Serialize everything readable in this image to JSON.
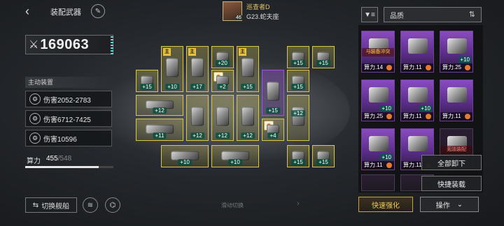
{
  "header": {
    "back_icon": "back-arrow-icon",
    "title": "装配武器",
    "edit_icon": "pencil-icon"
  },
  "pilot": {
    "name": "巡查者D",
    "level": "46",
    "ship": "G23.蛇夫座"
  },
  "power": {
    "value": "169063",
    "icon": "crossed-swords-icon"
  },
  "active_equipment": {
    "label": "主动装置",
    "items": [
      {
        "text": "伤害2052-2783",
        "icon": "gear-icon"
      },
      {
        "text": "伤害6712-7425",
        "icon": "gear-icon"
      },
      {
        "text": "伤害10596",
        "icon": "gear-icon"
      }
    ]
  },
  "capacity": {
    "label": "算力",
    "current": "455",
    "max": "/548",
    "fraction": 0.83
  },
  "bottom": {
    "switch_ship": "切换舰船",
    "swipe_hint": "滑动切换"
  },
  "slots": [
    {
      "level": "+15",
      "badge": ""
    },
    {
      "level": "+10",
      "badge": "主"
    },
    {
      "level": "+17",
      "badge": "主"
    },
    {
      "level": "+20",
      "badge": ""
    },
    {
      "level": "+15",
      "badge": "主"
    },
    {
      "level": "+15",
      "badge": ""
    },
    {
      "level": "+15",
      "badge": ""
    },
    {
      "level": "+2",
      "badge": ""
    },
    {
      "level": "+15",
      "badge": ""
    },
    {
      "level": "+15",
      "badge": ""
    },
    {
      "level": "+12",
      "badge": ""
    },
    {
      "level": "+12",
      "badge": ""
    },
    {
      "level": "+12",
      "badge": ""
    },
    {
      "level": "+12",
      "badge": ""
    },
    {
      "level": "+11",
      "badge": ""
    },
    {
      "level": "+4",
      "badge": ""
    },
    {
      "level": "+10",
      "badge": ""
    },
    {
      "level": "+10",
      "badge": ""
    },
    {
      "level": "+15",
      "badge": ""
    },
    {
      "level": "+15",
      "badge": ""
    }
  ],
  "right_panel": {
    "filter_icon": "filter-icon",
    "sort_label": "品质",
    "sort_icon": "sort-icon",
    "cards": [
      {
        "power": "算力.14",
        "level": "",
        "warning": "与装备冲突"
      },
      {
        "power": "算力.11",
        "level": "",
        "warning": ""
      },
      {
        "power": "算力.25",
        "level": "+10",
        "warning": ""
      },
      {
        "power": "算力.25",
        "level": "+10",
        "warning": ""
      },
      {
        "power": "算力.11",
        "level": "+10",
        "warning": ""
      },
      {
        "power": "算力.11",
        "level": "",
        "warning": ""
      },
      {
        "power": "算力.11",
        "level": "+10",
        "warning": ""
      },
      {
        "power": "算力.11",
        "level": "",
        "warning": ""
      },
      {
        "power": "",
        "level": "",
        "warning": "无法装配"
      }
    ],
    "popup": {
      "unload_all": "全部卸下",
      "quick_equip": "快捷装载"
    },
    "quick_enhance": "快速强化",
    "operate": "操作"
  }
}
